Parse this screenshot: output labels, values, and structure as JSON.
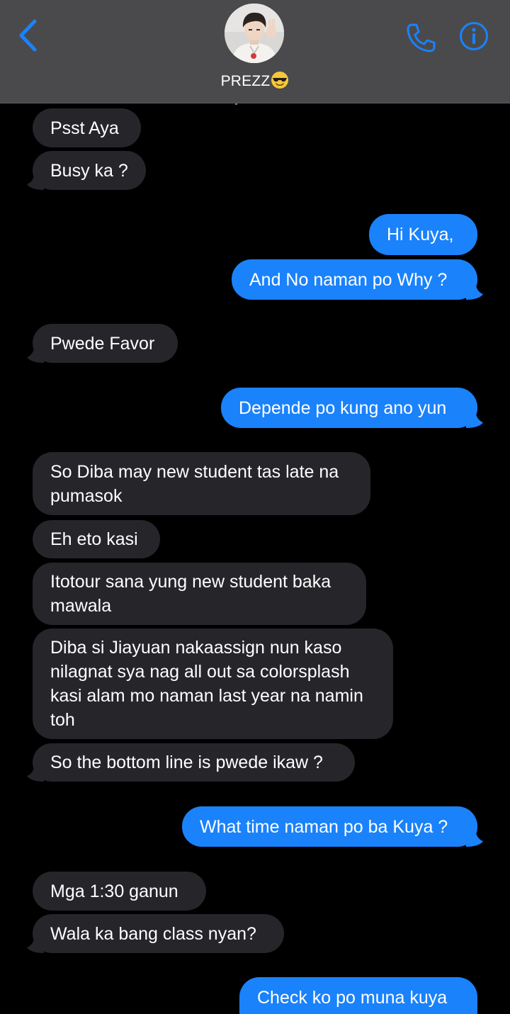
{
  "header": {
    "contact_name": "PREZZ",
    "icons": {
      "back": "chevron-left-icon",
      "phone": "phone-icon",
      "info": "info-icon",
      "status_emoji": "sunglasses-emoji-icon"
    },
    "accent_color": "#1a82fb",
    "background_color": "#4a4a4c"
  },
  "colors": {
    "incoming_bubble": "#26252a",
    "outgoing_bubble": "#1a82fb",
    "text": "#ffffff",
    "background": "#000000"
  },
  "messages": [
    {
      "from": "them",
      "text": "Psst Aya"
    },
    {
      "from": "them",
      "text": "Busy ka ?"
    },
    {
      "from": "me",
      "text": "Hi Kuya,"
    },
    {
      "from": "me",
      "text": "And No naman po Why ?"
    },
    {
      "from": "them",
      "text": "Pwede Favor"
    },
    {
      "from": "me",
      "text": "Depende po kung ano yun"
    },
    {
      "from": "them",
      "text": "So Diba may new student tas late na\npumasok"
    },
    {
      "from": "them",
      "text": "Eh eto kasi"
    },
    {
      "from": "them",
      "text": "Itotour sana yung new student baka\nmawala"
    },
    {
      "from": "them",
      "text": "Diba si Jiayuan nakaassign nun kaso\nnilagnat sya nag all out sa colorsplash\nkasi alam mo naman last year na namin\ntoh"
    },
    {
      "from": "them",
      "text": "So the bottom line is pwede ikaw ?"
    },
    {
      "from": "me",
      "text": "What time naman po ba Kuya ?"
    },
    {
      "from": "them",
      "text": "Mga 1:30 ganun"
    },
    {
      "from": "them",
      "text": "Wala ka bang class nyan?"
    },
    {
      "from": "me",
      "text": "Check ko po muna kuya"
    }
  ]
}
